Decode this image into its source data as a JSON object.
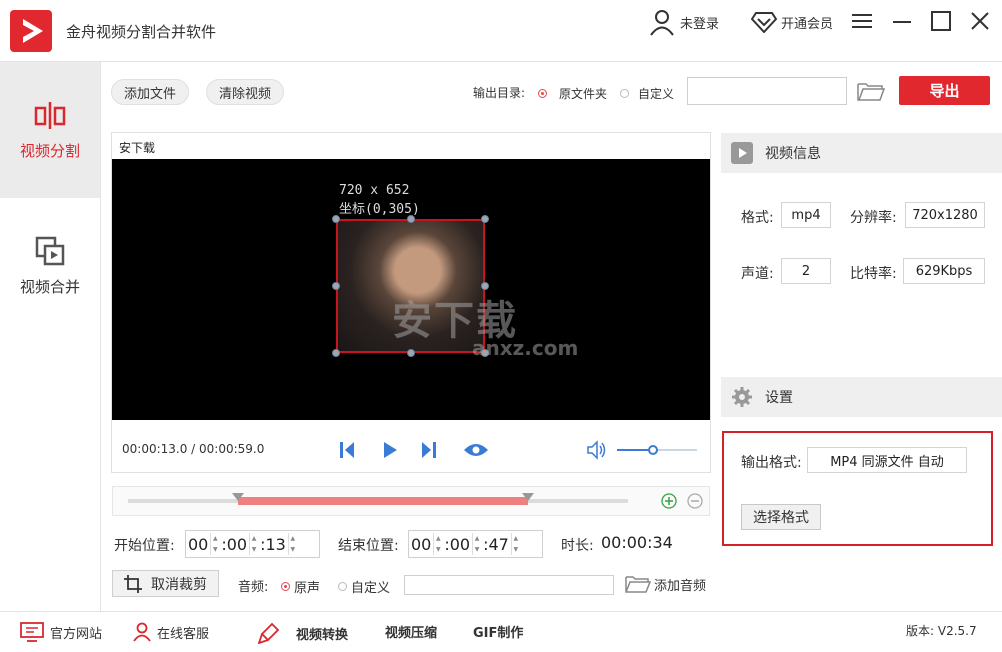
{
  "app": {
    "title": "金舟视频分割合并软件",
    "login_label": "未登录",
    "vip_label": "开通会员",
    "accent_color": "#e0282e"
  },
  "sidebar": {
    "items": [
      {
        "label": "视频分割",
        "icon": "split-icon",
        "active": true
      },
      {
        "label": "视频合并",
        "icon": "merge-icon",
        "active": false
      }
    ]
  },
  "toolbar": {
    "add_file": "添加文件",
    "clear_video": "清除视频",
    "output_dir_label": "输出目录:",
    "output_options": [
      {
        "label": "原文件夹",
        "selected": true
      },
      {
        "label": "自定义",
        "selected": false
      }
    ],
    "output_path_value": "",
    "export_label": "导出"
  },
  "preview": {
    "title": "安下载",
    "dimension_text": "720 x 652",
    "coord_text": "坐标(0,305)",
    "watermark": "安下载",
    "watermark_sub": "anxz.com",
    "time_readout": "00:00:13.0 / 00:00:59.0",
    "volume_level": 0.45
  },
  "timeline": {
    "start_fraction": 0.22,
    "end_fraction": 0.8
  },
  "trim": {
    "start_label": "开始位置:",
    "start": [
      "00",
      ":00",
      ":13"
    ],
    "end_label": "结束位置:",
    "end": [
      "00",
      ":00",
      ":47"
    ],
    "duration_label": "时长:",
    "duration_value": "00:00:34"
  },
  "bottom": {
    "cancel_crop": "取消裁剪",
    "audio_label": "音频:",
    "audio_options": [
      {
        "label": "原声",
        "selected": true
      },
      {
        "label": "自定义",
        "selected": false
      }
    ],
    "audio_path_value": "",
    "add_audio": "添加音频"
  },
  "video_info": {
    "header": "视频信息",
    "format_label": "格式:",
    "format_value": "mp4",
    "resolution_label": "分辨率:",
    "resolution_value": "720x1280",
    "channel_label": "声道:",
    "channel_value": "2",
    "bitrate_label": "比特率:",
    "bitrate_value": "629Kbps"
  },
  "settings": {
    "header": "设置",
    "output_format_label": "输出格式:",
    "output_format_value": "MP4 同源文件 自动",
    "choose_format": "选择格式"
  },
  "statusbar": {
    "website": "官方网站",
    "support": "在线客服",
    "convert": "视频转换",
    "compress": "视频压缩",
    "gif": "GIF制作",
    "version": "版本: V2.5.7"
  }
}
